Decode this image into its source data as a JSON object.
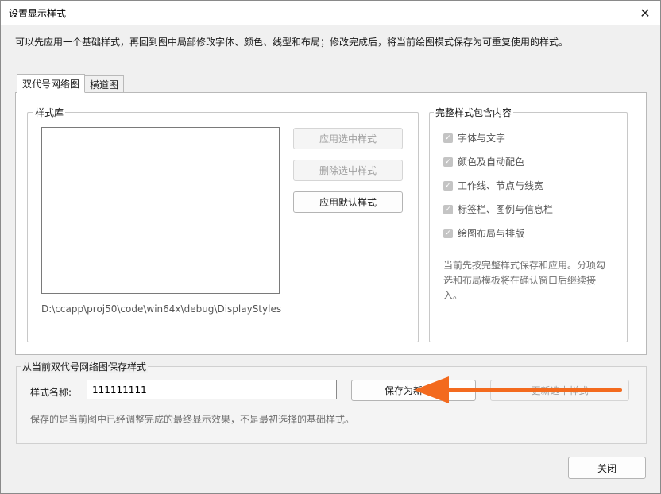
{
  "window": {
    "title": "设置显示样式",
    "close_glyph": "✕"
  },
  "intro_text": "可以先应用一个基础样式，再回到图中局部修改字体、颜色、线型和布局；修改完成后，将当前绘图模式保存为可重复使用的样式。",
  "tabs": [
    {
      "label": "双代号网络图",
      "active": true
    },
    {
      "label": "横道图",
      "active": false
    }
  ],
  "style_library": {
    "group_label": "样式库",
    "apply_selected_label": "应用选中样式",
    "delete_selected_label": "删除选中样式",
    "apply_default_label": "应用默认样式",
    "path_text": "D:\\ccapp\\proj50\\code\\win64x\\debug\\DisplayStyles"
  },
  "full_style_contents": {
    "group_label": "完整样式包含内容",
    "items": [
      {
        "label": "字体与文字",
        "checked": true
      },
      {
        "label": "颜色及自动配色",
        "checked": true
      },
      {
        "label": "工作线、节点与线宽",
        "checked": true
      },
      {
        "label": "标签栏、图例与信息栏",
        "checked": true
      },
      {
        "label": "绘图布局与排版",
        "checked": true
      }
    ],
    "note": "当前先按完整样式保存和应用。分项勾选和布局模板将在确认窗口后继续接入。"
  },
  "save_section": {
    "title": "从当前双代号网络图保存样式",
    "name_label": "样式名称:",
    "name_value": "111111111",
    "save_as_new_label": "保存为新",
    "update_selected_label": "更新选中样式",
    "note": "保存的是当前图中已经调整完成的最终显示效果，不是最初选择的基础样式。"
  },
  "close_button_label": "关闭",
  "colors": {
    "arrow": "#f36a1e",
    "accent_border": "#7a7a7a"
  }
}
